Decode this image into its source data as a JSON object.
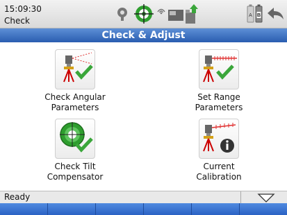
{
  "status_bar": {
    "time": "15:09:30",
    "context": "Check",
    "battery_label_a": "A",
    "battery_label_b": "B"
  },
  "title": "Check & Adjust",
  "tiles": [
    {
      "label_line1": "Check Angular",
      "label_line2": "Parameters"
    },
    {
      "label_line1": "Set Range",
      "label_line2": "Parameters"
    },
    {
      "label_line1": "Check Tilt",
      "label_line2": "Compensator"
    },
    {
      "label_line1": "Current",
      "label_line2": "Calibration"
    }
  ],
  "bottom": {
    "status_text": "Ready"
  },
  "colors": {
    "title_bar": "#2a5db0",
    "softkey": "#3a73d4",
    "check_green": "#3aa63a"
  }
}
